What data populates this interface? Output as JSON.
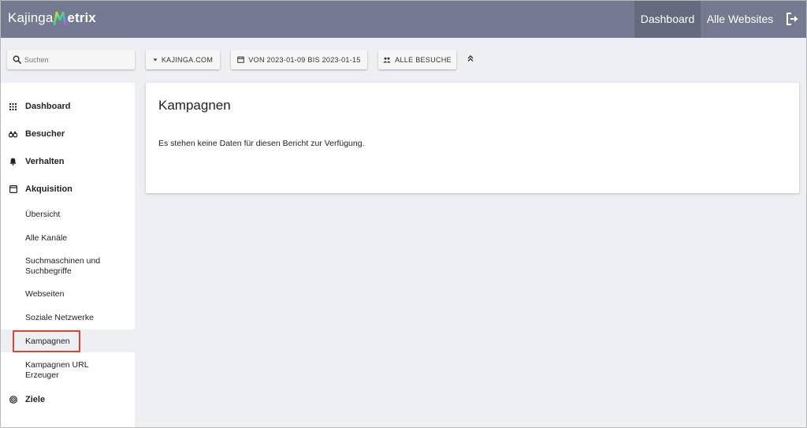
{
  "app": {
    "logo_prefix": "Kajinga",
    "logo_suffix": "etrix"
  },
  "topnav": {
    "dashboard": "Dashboard",
    "all_websites": "Alle Websites"
  },
  "toolbar": {
    "search_placeholder": "Suchen",
    "site": "KAJINGA.COM",
    "date_range": "VON 2023-01-09 BIS 2023-01-15",
    "segment": "ALLE BESUCHE"
  },
  "sidebar": {
    "dashboard": "Dashboard",
    "visitors": "Besucher",
    "behaviour": "Verhalten",
    "acquisition": "Akquisition",
    "acq_items": {
      "overview": "Übersicht",
      "all_channels": "Alle Kanäle",
      "search_engines": "Suchmaschinen und Suchbegriffe",
      "websites": "Webseiten",
      "social": "Soziale Netzwerke",
      "campaigns": "Kampagnen",
      "campaign_url_builder": "Kampagnen URL Erzeuger"
    },
    "goals": "Ziele"
  },
  "main": {
    "title": "Kampagnen",
    "message": "Es stehen keine Daten für diesen Bericht zur Verfügung."
  },
  "colors": {
    "topbar": "#747a8f",
    "topbar_active": "#656b7f",
    "highlight": "#e0432f",
    "background": "#eeeff2"
  }
}
